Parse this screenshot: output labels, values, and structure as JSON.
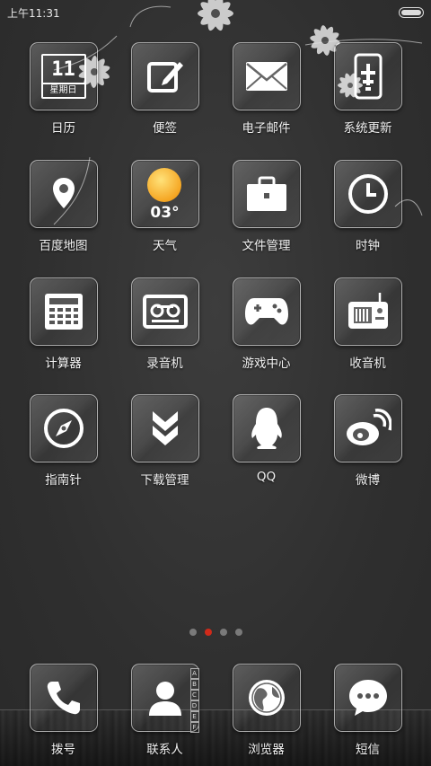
{
  "status_bar": {
    "time": "上午11:31"
  },
  "apps": [
    {
      "id": "calendar",
      "label": "日历",
      "icon": "calendar-icon",
      "day": "11",
      "weekday": "星期日"
    },
    {
      "id": "notes",
      "label": "便签",
      "icon": "edit-note-icon"
    },
    {
      "id": "email",
      "label": "电子邮件",
      "icon": "envelope-icon"
    },
    {
      "id": "update",
      "label": "系统更新",
      "icon": "phone-update-icon"
    },
    {
      "id": "maps",
      "label": "百度地图",
      "icon": "map-pin-icon"
    },
    {
      "id": "weather",
      "label": "天气",
      "icon": "sun-icon",
      "temperature": "03°"
    },
    {
      "id": "files",
      "label": "文件管理",
      "icon": "briefcase-icon"
    },
    {
      "id": "clock",
      "label": "时钟",
      "icon": "clock-icon"
    },
    {
      "id": "calculator",
      "label": "计算器",
      "icon": "calculator-icon"
    },
    {
      "id": "recorder",
      "label": "录音机",
      "icon": "cassette-icon"
    },
    {
      "id": "games",
      "label": "游戏中心",
      "icon": "gamepad-icon"
    },
    {
      "id": "radio",
      "label": "收音机",
      "icon": "radio-icon"
    },
    {
      "id": "compass",
      "label": "指南针",
      "icon": "compass-icon"
    },
    {
      "id": "downloads",
      "label": "下载管理",
      "icon": "download-chevrons-icon"
    },
    {
      "id": "qq",
      "label": "QQ",
      "icon": "penguin-icon"
    },
    {
      "id": "weibo",
      "label": "微博",
      "icon": "weibo-icon"
    }
  ],
  "pager": {
    "pages": 4,
    "active": 2
  },
  "dock": [
    {
      "id": "dialer",
      "label": "拨号",
      "icon": "phone-handset-icon"
    },
    {
      "id": "contacts",
      "label": "联系人",
      "icon": "contact-person-icon",
      "index_letters": [
        "A",
        "B",
        "C",
        "D",
        "E",
        "F"
      ]
    },
    {
      "id": "browser",
      "label": "浏览器",
      "icon": "globe-icon"
    },
    {
      "id": "sms",
      "label": "短信",
      "icon": "chat-bubble-icon"
    }
  ],
  "colors": {
    "background": "#333333",
    "active_dot": "#d02a1a",
    "weather_sun": "#f5a623"
  }
}
